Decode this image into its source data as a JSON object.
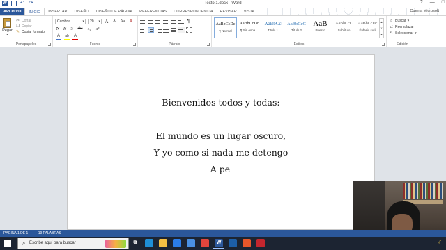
{
  "window": {
    "title": "Texto 1.docx - Word",
    "account": "Cuenta Microsoft",
    "controls": [
      "?",
      "—",
      "□"
    ]
  },
  "quick_access": {
    "app_icon_letter": "W"
  },
  "tabs": [
    {
      "label": "ARCHIVO",
      "state": "file"
    },
    {
      "label": "INICIO",
      "state": "active"
    },
    {
      "label": "INSERTAR",
      "state": ""
    },
    {
      "label": "DISEÑO",
      "state": ""
    },
    {
      "label": "DISEÑO DE PÁGINA",
      "state": ""
    },
    {
      "label": "REFERENCIAS",
      "state": ""
    },
    {
      "label": "CORRESPONDENCIA",
      "state": ""
    },
    {
      "label": "REVISAR",
      "state": ""
    },
    {
      "label": "VISTA",
      "state": ""
    }
  ],
  "ribbon": {
    "clipboard": {
      "label": "Portapapeles",
      "paste": "Pegar",
      "cut": "Cortar",
      "copy": "Copiar",
      "format_painter": "Copiar formato"
    },
    "font": {
      "label": "Fuente",
      "font_name": "Cambria",
      "font_size": "20",
      "grow": "A",
      "shrink": "A",
      "case": "Aa",
      "bold": "N",
      "italic": "K",
      "underline": "S",
      "strike": "abc",
      "subscript": "x₂",
      "superscript": "x²",
      "text_effects": "A",
      "highlight": "ab",
      "font_color": "A",
      "colors": {
        "highlight": "#ffff00",
        "font_color": "#e00000",
        "effects": "#4472c4"
      }
    },
    "paragraph": {
      "label": "Párrafo"
    },
    "styles": {
      "label": "Estilos",
      "items": [
        {
          "preview": "AaBbCcDc",
          "name": "¶ Normal",
          "selected": true,
          "size": "6px",
          "color": "#111"
        },
        {
          "preview": "AaBbCcDc",
          "name": "¶ Sin espa...",
          "selected": false,
          "size": "6px",
          "color": "#111"
        },
        {
          "preview": "AaBbCc",
          "name": "Título 1",
          "selected": false,
          "size": "7px",
          "color": "#2e74b5"
        },
        {
          "preview": "AaBbCcC",
          "name": "Título 2",
          "selected": false,
          "size": "6.5px",
          "color": "#2e74b5"
        },
        {
          "preview": "AaB",
          "name": "Puesto",
          "selected": false,
          "size": "11px",
          "color": "#111"
        },
        {
          "preview": "AaBbCcC",
          "name": "Subtítulo",
          "selected": false,
          "size": "6px",
          "color": "#666"
        },
        {
          "preview": "AaBbCcDc",
          "name": "Énfasis sutil",
          "selected": false,
          "size": "6px",
          "color": "#555"
        }
      ]
    },
    "editing": {
      "label": "Edición",
      "find": "Buscar",
      "replace": "Reemplazar",
      "select": "Seleccionar"
    }
  },
  "document": {
    "lines": [
      "Bienvenidos todos y todas:",
      "",
      "El mundo es un lugar oscuro,",
      "Y yo como si nada me detengo",
      "A pe"
    ]
  },
  "status": {
    "page": "PÁGINA 1 DE 1",
    "words": "19 PALABRAS"
  },
  "taskbar": {
    "search_placeholder": "Escribe aquí para buscar",
    "apps": [
      {
        "name": "task-view",
        "color": "#1c2432",
        "symbol": "⧉",
        "active": false
      },
      {
        "name": "edge",
        "color": "#1f8fd6",
        "symbol": "",
        "active": false
      },
      {
        "name": "file-explorer",
        "color": "#f5c043",
        "symbol": "",
        "active": false
      },
      {
        "name": "store",
        "color": "#2b7de9",
        "symbol": "",
        "active": false
      },
      {
        "name": "mail",
        "color": "#4a90e2",
        "symbol": "",
        "active": false
      },
      {
        "name": "chrome",
        "color": "#e2453c",
        "symbol": "",
        "active": false
      },
      {
        "name": "word",
        "color": "#2b579a",
        "symbol": "W",
        "active": true
      },
      {
        "name": "app-blue",
        "color": "#1d5fa8",
        "symbol": "",
        "active": false
      },
      {
        "name": "app-orange",
        "color": "#e8572a",
        "symbol": "",
        "active": false
      },
      {
        "name": "app-red",
        "color": "#c4262e",
        "symbol": "",
        "active": false
      }
    ]
  }
}
